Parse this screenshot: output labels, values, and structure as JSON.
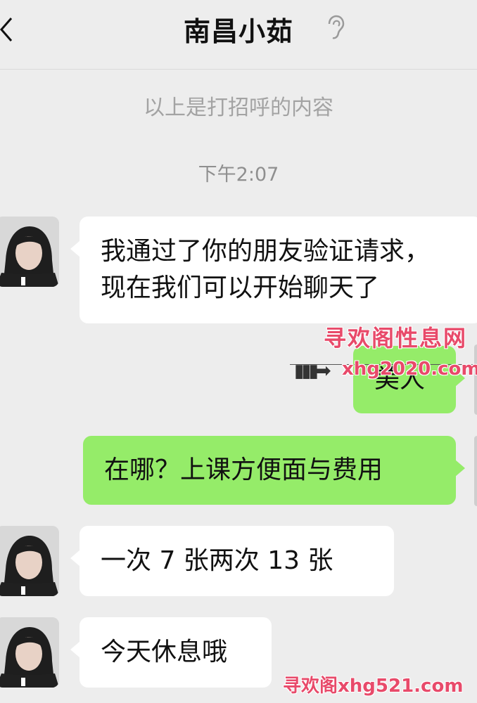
{
  "header": {
    "title": "南昌小茹",
    "back_icon": "chevron-left-icon",
    "voice_icon": "ear-icon"
  },
  "system_notice": "以上是打招呼的内容",
  "timestamp": "下午2:07",
  "messages": [
    {
      "from": "contact",
      "lines": [
        "我通过了你的朋友验证请求，",
        "现在我们可以开始聊天了"
      ]
    },
    {
      "from": "me",
      "text": "美人"
    },
    {
      "from": "me",
      "text": "在哪？上课方便面与费用"
    },
    {
      "from": "contact",
      "text": "一次 7 张两次 13 张"
    },
    {
      "from": "contact",
      "text": "今天休息哦"
    }
  ],
  "watermarks": {
    "site_name": "寻欢阁性息网",
    "domain1": "xhg2020.com",
    "bottom": "寻欢阁xhg521.com",
    "arrow": "▮▮▮➡"
  },
  "colors": {
    "background": "#ededed",
    "outgoing_bubble": "#95ec69",
    "incoming_bubble": "#ffffff",
    "watermark": "#e84a6a"
  }
}
